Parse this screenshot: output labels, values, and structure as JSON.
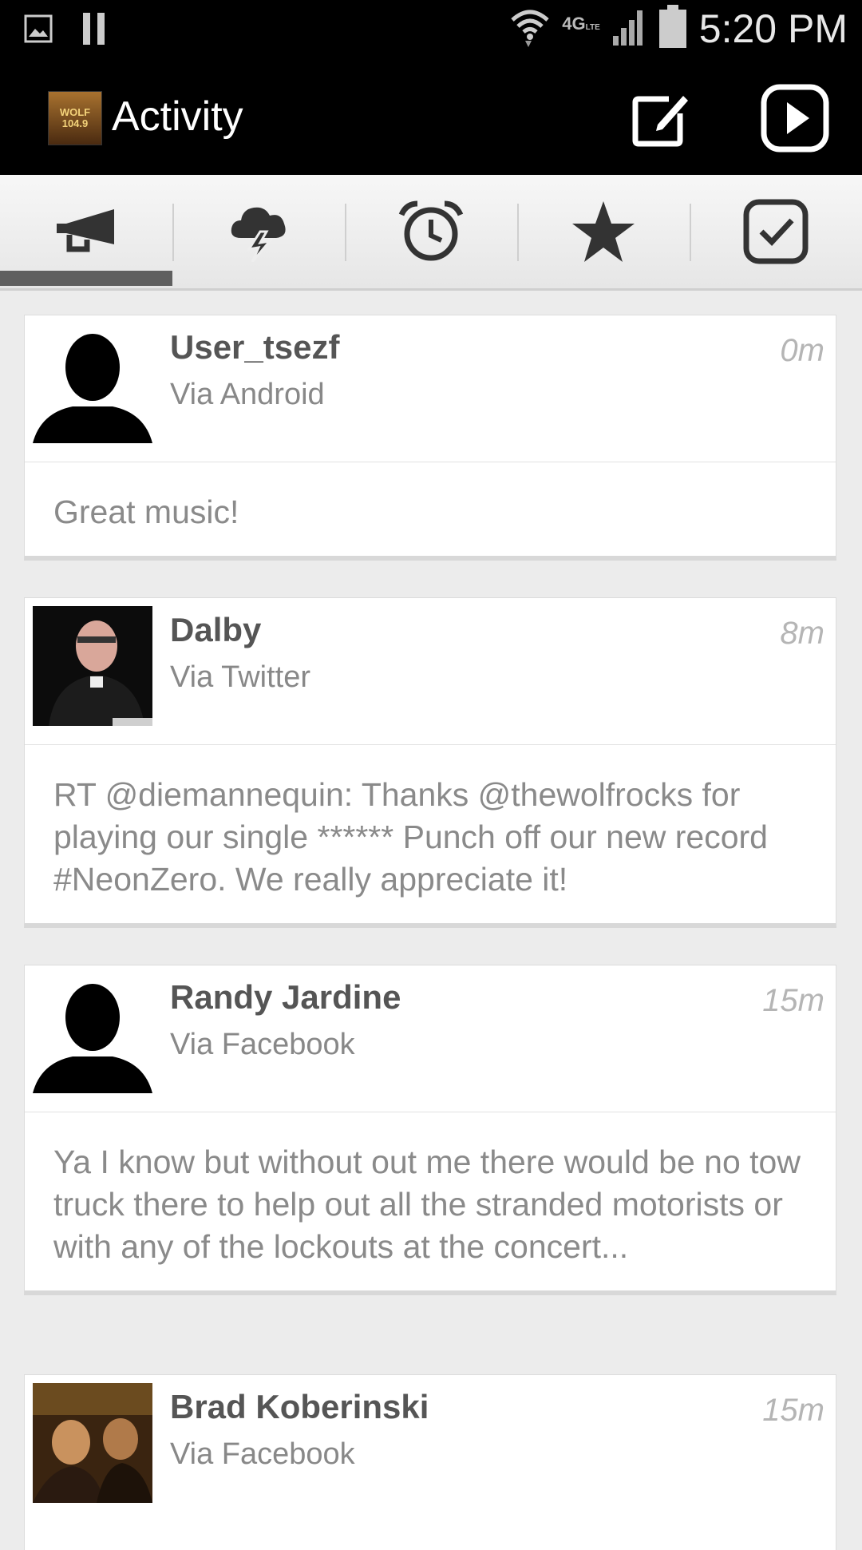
{
  "status_bar": {
    "time": "5:20 PM",
    "network": "4G",
    "network_sub": "LTE",
    "icons": [
      "image-icon",
      "pause-icon",
      "wifi-icon",
      "signal-icon",
      "battery-icon"
    ]
  },
  "action_bar": {
    "title": "Activity",
    "logo_text": "WOLF 104.9",
    "actions": [
      "compose-icon",
      "play-icon"
    ]
  },
  "tabs": [
    {
      "icon": "megaphone-icon",
      "selected": true
    },
    {
      "icon": "storm-cloud-icon",
      "selected": false
    },
    {
      "icon": "alarm-clock-icon",
      "selected": false
    },
    {
      "icon": "star-icon",
      "selected": false
    },
    {
      "icon": "checkbox-icon",
      "selected": false
    }
  ],
  "feed": [
    {
      "user": "User_tsezf",
      "via": "Via Android",
      "time": "0m",
      "message": "Great music!",
      "avatar": "silhouette"
    },
    {
      "user": "Dalby",
      "via": "Via Twitter",
      "time": "8m",
      "message": "RT @diemannequin: Thanks @thewolfrocks for playing our single ****** Punch off our new record #NeonZero. We really appreciate it!",
      "avatar": "photo"
    },
    {
      "user": "Randy Jardine",
      "via": "Via Facebook",
      "time": "15m",
      "message": "Ya I know but without out me there would be no tow truck there to help out all the stranded motorists or with any of the lockouts at the concert...",
      "avatar": "silhouette"
    },
    {
      "user": "Brad Koberinski",
      "via": "Via Facebook",
      "time": "15m",
      "message": "",
      "avatar": "photo"
    }
  ],
  "colors": {
    "action_bar_bg": "#000000",
    "page_bg": "#ececec",
    "tab_indicator": "#5f5f5f",
    "name_text": "#555555",
    "body_text": "#8a8a8a"
  }
}
